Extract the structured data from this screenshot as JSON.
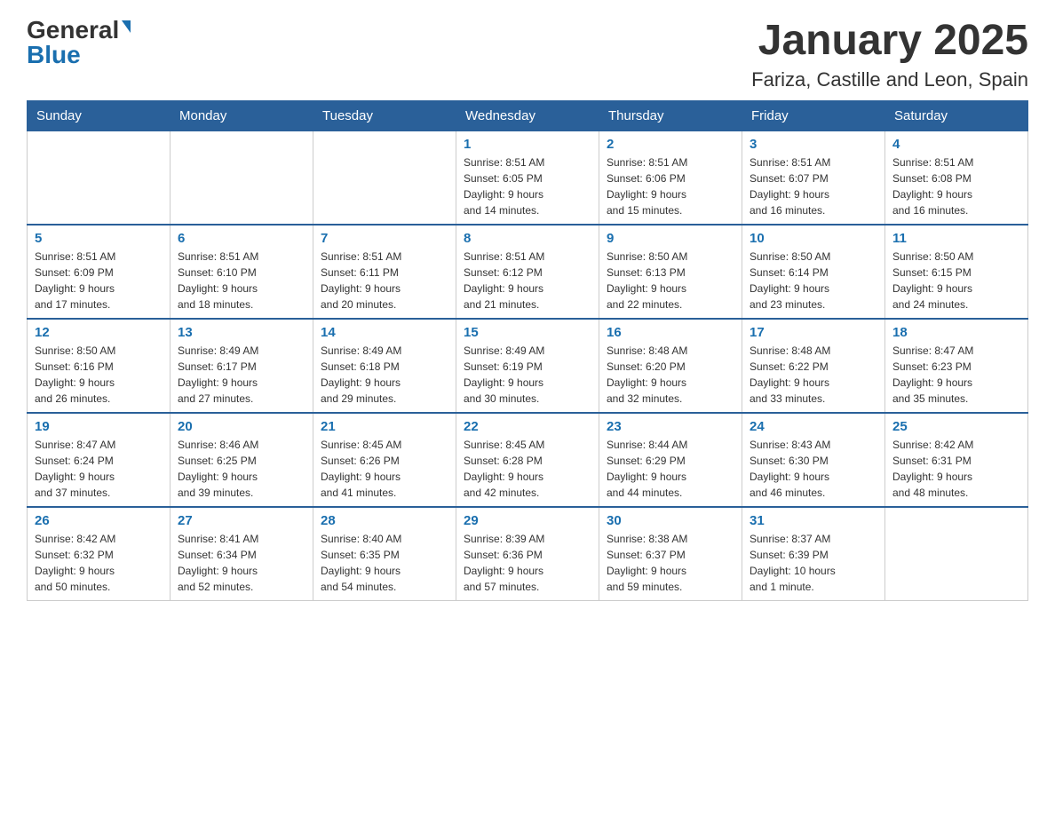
{
  "header": {
    "logo_general": "General",
    "logo_blue": "Blue",
    "month_title": "January 2025",
    "location": "Fariza, Castille and Leon, Spain"
  },
  "days_of_week": [
    "Sunday",
    "Monday",
    "Tuesday",
    "Wednesday",
    "Thursday",
    "Friday",
    "Saturday"
  ],
  "weeks": [
    {
      "days": [
        {
          "num": "",
          "info": ""
        },
        {
          "num": "",
          "info": ""
        },
        {
          "num": "",
          "info": ""
        },
        {
          "num": "1",
          "info": "Sunrise: 8:51 AM\nSunset: 6:05 PM\nDaylight: 9 hours\nand 14 minutes."
        },
        {
          "num": "2",
          "info": "Sunrise: 8:51 AM\nSunset: 6:06 PM\nDaylight: 9 hours\nand 15 minutes."
        },
        {
          "num": "3",
          "info": "Sunrise: 8:51 AM\nSunset: 6:07 PM\nDaylight: 9 hours\nand 16 minutes."
        },
        {
          "num": "4",
          "info": "Sunrise: 8:51 AM\nSunset: 6:08 PM\nDaylight: 9 hours\nand 16 minutes."
        }
      ]
    },
    {
      "days": [
        {
          "num": "5",
          "info": "Sunrise: 8:51 AM\nSunset: 6:09 PM\nDaylight: 9 hours\nand 17 minutes."
        },
        {
          "num": "6",
          "info": "Sunrise: 8:51 AM\nSunset: 6:10 PM\nDaylight: 9 hours\nand 18 minutes."
        },
        {
          "num": "7",
          "info": "Sunrise: 8:51 AM\nSunset: 6:11 PM\nDaylight: 9 hours\nand 20 minutes."
        },
        {
          "num": "8",
          "info": "Sunrise: 8:51 AM\nSunset: 6:12 PM\nDaylight: 9 hours\nand 21 minutes."
        },
        {
          "num": "9",
          "info": "Sunrise: 8:50 AM\nSunset: 6:13 PM\nDaylight: 9 hours\nand 22 minutes."
        },
        {
          "num": "10",
          "info": "Sunrise: 8:50 AM\nSunset: 6:14 PM\nDaylight: 9 hours\nand 23 minutes."
        },
        {
          "num": "11",
          "info": "Sunrise: 8:50 AM\nSunset: 6:15 PM\nDaylight: 9 hours\nand 24 minutes."
        }
      ]
    },
    {
      "days": [
        {
          "num": "12",
          "info": "Sunrise: 8:50 AM\nSunset: 6:16 PM\nDaylight: 9 hours\nand 26 minutes."
        },
        {
          "num": "13",
          "info": "Sunrise: 8:49 AM\nSunset: 6:17 PM\nDaylight: 9 hours\nand 27 minutes."
        },
        {
          "num": "14",
          "info": "Sunrise: 8:49 AM\nSunset: 6:18 PM\nDaylight: 9 hours\nand 29 minutes."
        },
        {
          "num": "15",
          "info": "Sunrise: 8:49 AM\nSunset: 6:19 PM\nDaylight: 9 hours\nand 30 minutes."
        },
        {
          "num": "16",
          "info": "Sunrise: 8:48 AM\nSunset: 6:20 PM\nDaylight: 9 hours\nand 32 minutes."
        },
        {
          "num": "17",
          "info": "Sunrise: 8:48 AM\nSunset: 6:22 PM\nDaylight: 9 hours\nand 33 minutes."
        },
        {
          "num": "18",
          "info": "Sunrise: 8:47 AM\nSunset: 6:23 PM\nDaylight: 9 hours\nand 35 minutes."
        }
      ]
    },
    {
      "days": [
        {
          "num": "19",
          "info": "Sunrise: 8:47 AM\nSunset: 6:24 PM\nDaylight: 9 hours\nand 37 minutes."
        },
        {
          "num": "20",
          "info": "Sunrise: 8:46 AM\nSunset: 6:25 PM\nDaylight: 9 hours\nand 39 minutes."
        },
        {
          "num": "21",
          "info": "Sunrise: 8:45 AM\nSunset: 6:26 PM\nDaylight: 9 hours\nand 41 minutes."
        },
        {
          "num": "22",
          "info": "Sunrise: 8:45 AM\nSunset: 6:28 PM\nDaylight: 9 hours\nand 42 minutes."
        },
        {
          "num": "23",
          "info": "Sunrise: 8:44 AM\nSunset: 6:29 PM\nDaylight: 9 hours\nand 44 minutes."
        },
        {
          "num": "24",
          "info": "Sunrise: 8:43 AM\nSunset: 6:30 PM\nDaylight: 9 hours\nand 46 minutes."
        },
        {
          "num": "25",
          "info": "Sunrise: 8:42 AM\nSunset: 6:31 PM\nDaylight: 9 hours\nand 48 minutes."
        }
      ]
    },
    {
      "days": [
        {
          "num": "26",
          "info": "Sunrise: 8:42 AM\nSunset: 6:32 PM\nDaylight: 9 hours\nand 50 minutes."
        },
        {
          "num": "27",
          "info": "Sunrise: 8:41 AM\nSunset: 6:34 PM\nDaylight: 9 hours\nand 52 minutes."
        },
        {
          "num": "28",
          "info": "Sunrise: 8:40 AM\nSunset: 6:35 PM\nDaylight: 9 hours\nand 54 minutes."
        },
        {
          "num": "29",
          "info": "Sunrise: 8:39 AM\nSunset: 6:36 PM\nDaylight: 9 hours\nand 57 minutes."
        },
        {
          "num": "30",
          "info": "Sunrise: 8:38 AM\nSunset: 6:37 PM\nDaylight: 9 hours\nand 59 minutes."
        },
        {
          "num": "31",
          "info": "Sunrise: 8:37 AM\nSunset: 6:39 PM\nDaylight: 10 hours\nand 1 minute."
        },
        {
          "num": "",
          "info": ""
        }
      ]
    }
  ]
}
